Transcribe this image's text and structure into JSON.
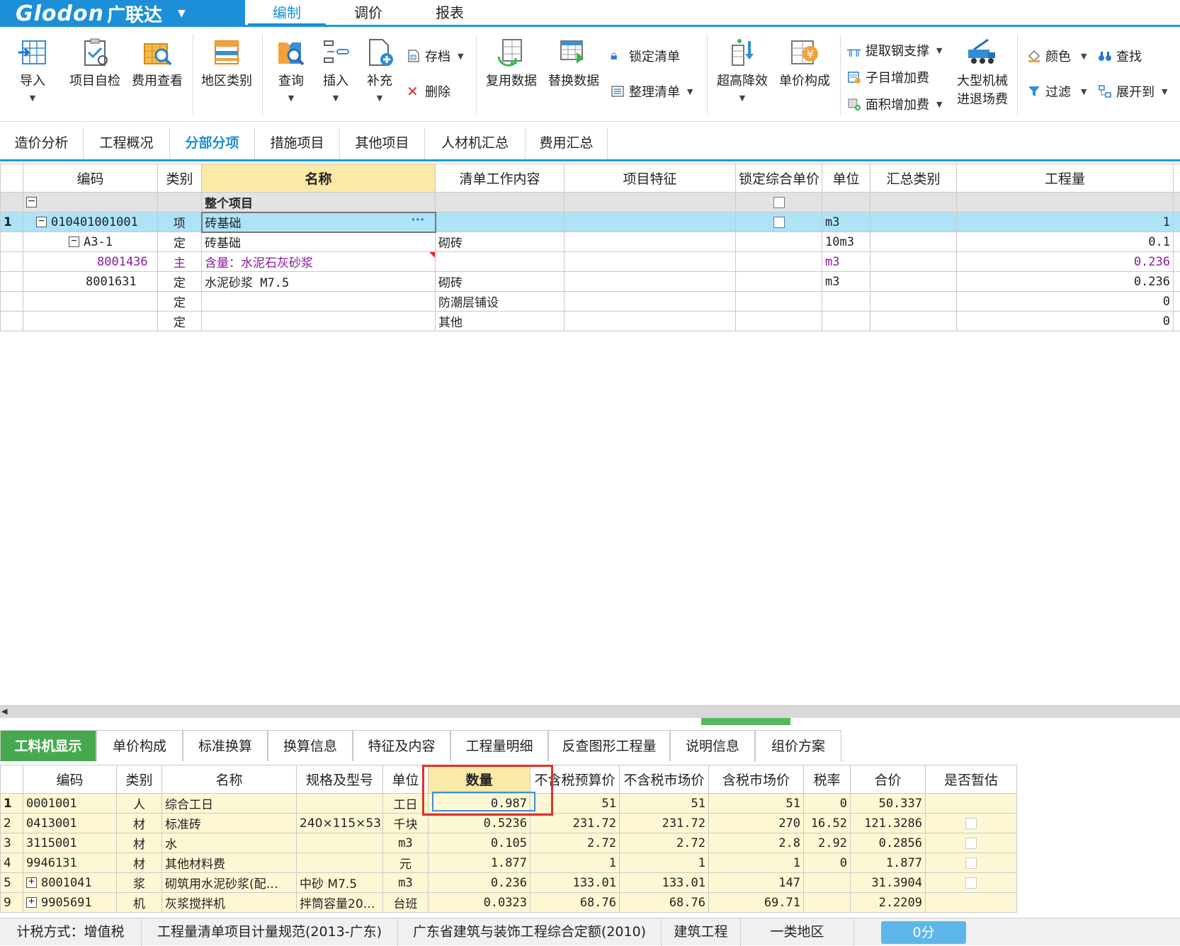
{
  "app": {
    "brand": "Glodon",
    "brand_cn": "广联达"
  },
  "menu_tabs": [
    "编制",
    "调价",
    "报表"
  ],
  "ribbon": {
    "import": "导入",
    "self_check": "项目自检",
    "fee_view": "费用查看",
    "region_type": "地区类别",
    "query": "查询",
    "insert": "插入",
    "supplement": "补充",
    "archive": "存档",
    "delete": "删除",
    "reuse_data": "复用数据",
    "replace_data": "替换数据",
    "lock_list": "锁定清单",
    "arrange_list": "整理清单",
    "super_high": "超高降效",
    "unit_price": "单价构成",
    "extract_steel": "提取钢支撑",
    "sub_add_fee": "子目增加费",
    "area_add_fee": "面积增加费",
    "large_machine_1": "大型机械",
    "large_machine_2": "进退场费",
    "color": "颜色",
    "find": "查找",
    "filter": "过滤",
    "expand_to": "展开到"
  },
  "view_tabs": [
    "造价分析",
    "工程概况",
    "分部分项",
    "措施项目",
    "其他项目",
    "人材机汇总",
    "费用汇总"
  ],
  "grid1": {
    "headers": [
      "编码",
      "类别",
      "名称",
      "清单工作内容",
      "项目特征",
      "锁定综合单价",
      "单位",
      "汇总类别",
      "工程量"
    ],
    "top_row": {
      "name": "整个项目"
    },
    "rows": [
      {
        "no": "1",
        "code": "010401001001",
        "type": "项",
        "name": "砖基础",
        "work": "",
        "unit": "m3",
        "qty": "1"
      },
      {
        "no": "",
        "code": "A3-1",
        "type": "定",
        "name": "砖基础",
        "work": "砌砖",
        "unit": "10m3",
        "qty": "0.1"
      },
      {
        "no": "",
        "code": "8001436",
        "type": "主",
        "name": "含量：水泥石灰砂浆",
        "work": "",
        "unit": "m3",
        "qty": "0.236"
      },
      {
        "no": "",
        "code": "8001631",
        "type": "定",
        "name": "水泥砂浆 M7.5",
        "work": "砌砖",
        "unit": "m3",
        "qty": "0.236"
      },
      {
        "no": "",
        "code": "",
        "type": "定",
        "name": "",
        "work": "防潮层铺设",
        "unit": "",
        "qty": "0"
      },
      {
        "no": "",
        "code": "",
        "type": "定",
        "name": "",
        "work": "其他",
        "unit": "",
        "qty": "0"
      }
    ],
    "ellipsis": "···"
  },
  "lower_tabs": [
    "工料机显示",
    "单价构成",
    "标准换算",
    "换算信息",
    "特征及内容",
    "工程量明细",
    "反查图形工程量",
    "说明信息",
    "组价方案"
  ],
  "grid2": {
    "headers": [
      "编码",
      "类别",
      "名称",
      "规格及型号",
      "单位",
      "数量",
      "不含税预算价",
      "不含税市场价",
      "含税市场价",
      "税率",
      "合价",
      "是否暂估"
    ],
    "rows": [
      {
        "no": "1",
        "code": "0001001",
        "type": "人",
        "name": "综合工日",
        "spec": "",
        "unit": "工日",
        "qty": "0.987",
        "p1": "51",
        "p2": "51",
        "p3": "51",
        "tax": "0",
        "total": "50.337"
      },
      {
        "no": "2",
        "code": "0413001",
        "type": "材",
        "name": "标准砖",
        "spec": "240×115×53",
        "unit": "千块",
        "qty": "0.5236",
        "p1": "231.72",
        "p2": "231.72",
        "p3": "270",
        "tax": "16.52",
        "total": "121.3286"
      },
      {
        "no": "3",
        "code": "3115001",
        "type": "材",
        "name": "水",
        "spec": "",
        "unit": "m3",
        "qty": "0.105",
        "p1": "2.72",
        "p2": "2.72",
        "p3": "2.8",
        "tax": "2.92",
        "total": "0.2856"
      },
      {
        "no": "4",
        "code": "9946131",
        "type": "材",
        "name": "其他材料费",
        "spec": "",
        "unit": "元",
        "qty": "1.877",
        "p1": "1",
        "p2": "1",
        "p3": "1",
        "tax": "0",
        "total": "1.877"
      },
      {
        "no": "5",
        "code": "8001041",
        "type": "浆",
        "name": "砌筑用水泥砂浆(配…",
        "spec": "中砂 M7.5",
        "unit": "m3",
        "qty": "0.236",
        "p1": "133.01",
        "p2": "133.01",
        "p3": "147",
        "tax": "",
        "total": "31.3904"
      },
      {
        "no": "9",
        "code": "9905691",
        "type": "机",
        "name": "灰浆搅拌机",
        "spec": "拌筒容量20…",
        "unit": "台班",
        "qty": "0.0323",
        "p1": "68.76",
        "p2": "68.76",
        "p3": "69.71",
        "tax": "",
        "total": "2.2209"
      }
    ]
  },
  "status": {
    "tax_method": "计税方式：增值税",
    "standard": "工程量清单项目计量规范(2013-广东)",
    "quota": "广东省建筑与装饰工程综合定额(2010)",
    "project_type": "建筑工程",
    "region": "一类地区",
    "score": "0分"
  },
  "colors": {
    "accent": "#1a9be0",
    "green_tab": "#47a94f",
    "selected_row": "#aee3f7",
    "yellow_cell": "#fdf8d3"
  }
}
